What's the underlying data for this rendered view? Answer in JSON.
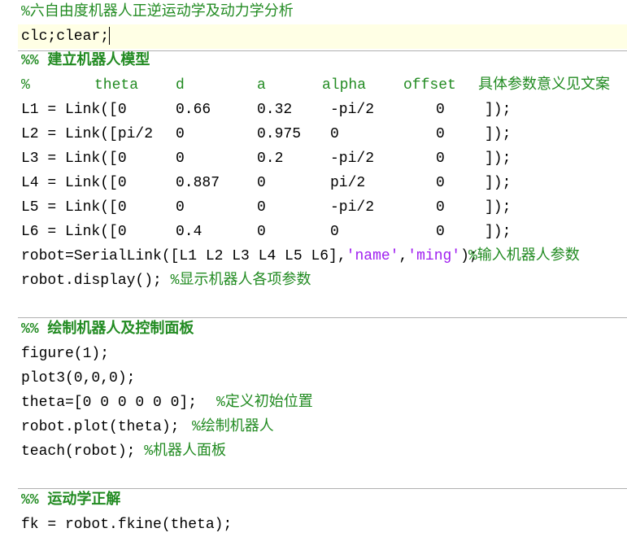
{
  "lines": {
    "l0": "%六自由度机器人正逆运动学及动力学分析",
    "l1": "clc;clear;",
    "l2": "%% 建立机器人模型",
    "cols": [
      "%",
      "theta",
      "d",
      "a",
      "alpha",
      "offset",
      "具体参数意义见文案"
    ],
    "links": [
      {
        "name": "L1 = Link([0",
        "d": "0.66",
        "a": "0.32",
        "alpha": "-pi/2",
        "offset": "0",
        "end": "]);"
      },
      {
        "name": "L2 = Link([pi/2",
        "d": "0",
        "a": "0.975",
        "alpha": "0",
        "offset": "0",
        "end": "]);"
      },
      {
        "name": "L3 = Link([0",
        "d": "0",
        "a": "0.2",
        "alpha": "-pi/2",
        "offset": "0",
        "end": "]);"
      },
      {
        "name": "L4 = Link([0",
        "d": "0.887",
        "a": "0",
        "alpha": "pi/2",
        "offset": "0",
        "end": "]);"
      },
      {
        "name": "L5 = Link([0",
        "d": "0",
        "a": "0",
        "alpha": "-pi/2",
        "offset": "0",
        "end": "]);"
      },
      {
        "name": "L6 = Link([0",
        "d": "0.4",
        "a": "0",
        "alpha": "0",
        "offset": "0",
        "end": "]);"
      }
    ],
    "robot_a": "robot=SerialLink([L1 L2 L3 L4 L5 L6],",
    "robot_s1": "'name'",
    "robot_c": ",",
    "robot_s2": "'ming'",
    "robot_e": ");",
    "robot_comment": "%输入机器人参数",
    "display_code": "robot.display(); ",
    "display_comment": "%显示机器人各项参数",
    "cell2": "%% 绘制机器人及控制面板",
    "figure": "figure(1);",
    "plot3": "plot3(0,0,0);",
    "theta_code": "theta=[0 0 0 0 0 0];",
    "theta_comment": "%定义初始位置",
    "plot_code": "robot.plot(theta);",
    "plot_comment": "%绘制机器人",
    "teach_code": "teach(robot); ",
    "teach_comment": "%机器人面板",
    "cell3": "%% 运动学正解",
    "fkine_partial": "fk = robot.fkine(theta);"
  }
}
